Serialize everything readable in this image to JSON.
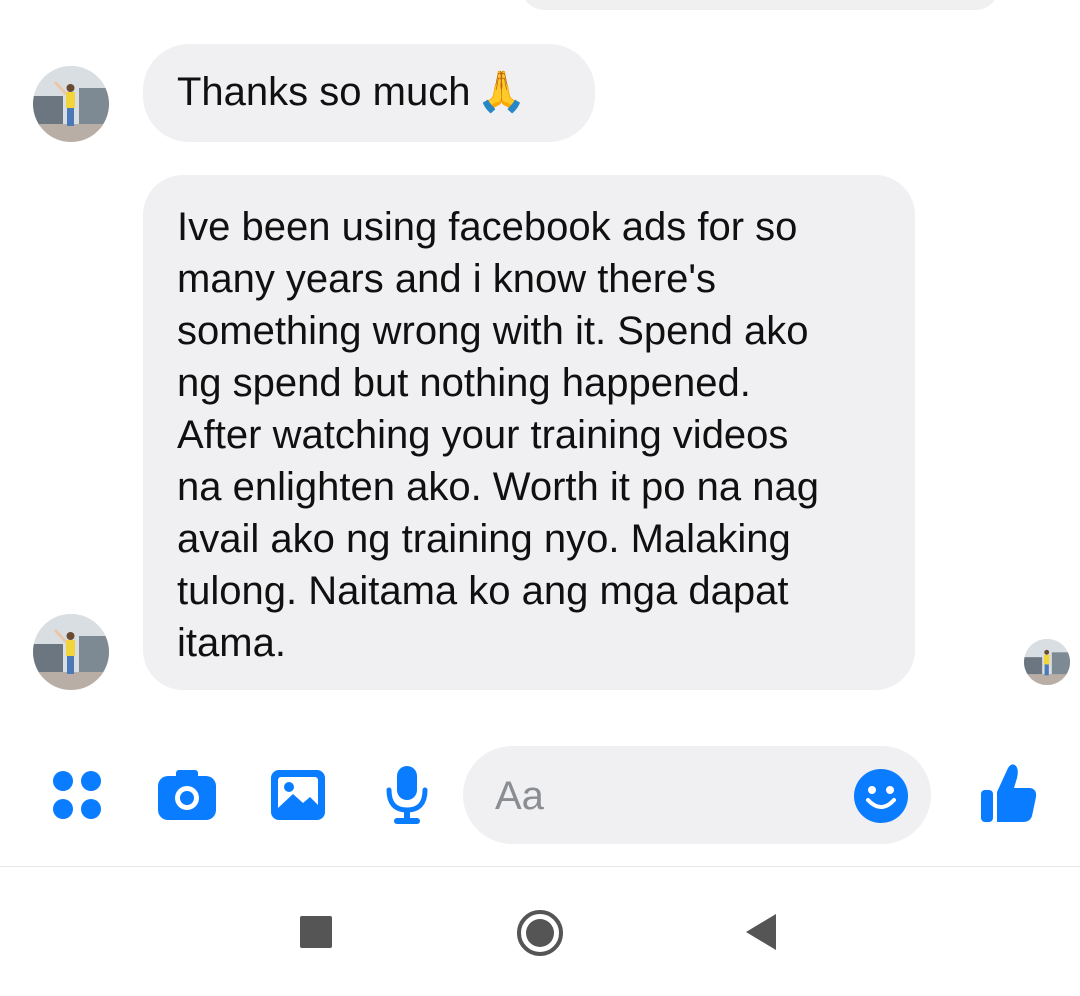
{
  "conversation": {
    "messages": [
      {
        "text": "Thanks so much",
        "emoji": "🙏"
      },
      {
        "lines": [
          "Ive been using facebook ads for so",
          "many years and i know there's",
          "something wrong with it. Spend ako",
          "ng spend but nothing happened.",
          "After watching your training videos",
          "na enlighten ako. Worth it po na nag",
          "avail ako ng training nyo. Malaking",
          "tulong. Naitama ko ang mga dapat",
          "itama."
        ]
      }
    ]
  },
  "composer": {
    "placeholder": "Aa",
    "icons": [
      "menu-grid-icon",
      "camera-icon",
      "gallery-icon",
      "microphone-icon",
      "emoji-icon",
      "thumbs-up-icon"
    ]
  },
  "navbar": {
    "icons": [
      "recents-icon",
      "home-icon",
      "back-icon"
    ]
  },
  "colors": {
    "accent": "#0a7cff",
    "bubble": "#f0f0f2",
    "nav": "#555555"
  }
}
